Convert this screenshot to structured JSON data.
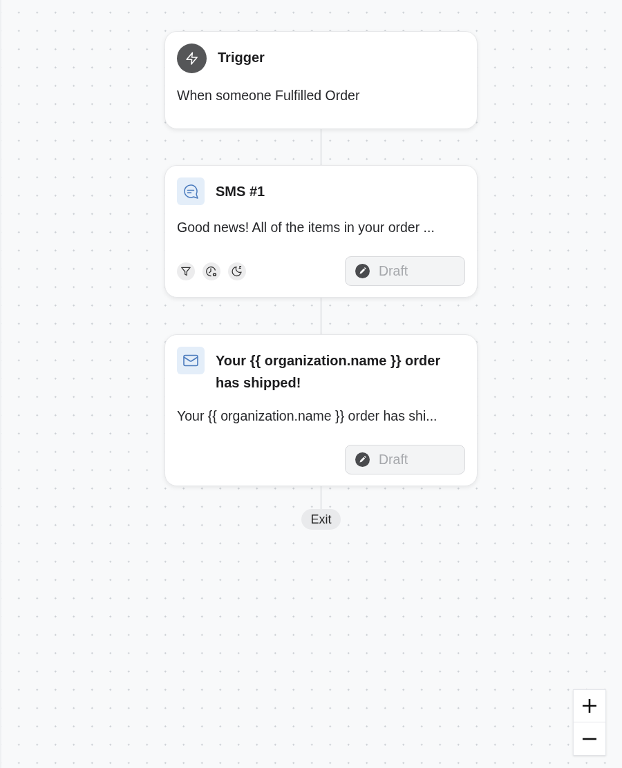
{
  "nodes": [
    {
      "kind": "trigger",
      "title": "Trigger",
      "description": "When someone Fulfilled Order"
    },
    {
      "kind": "sms",
      "title": "SMS #1",
      "description": "Good news! All of the items in your order ...",
      "indicators": [
        {
          "kind": "filter"
        },
        {
          "kind": "smart_sending"
        },
        {
          "kind": "quiet_hours"
        }
      ],
      "status": "Draft"
    },
    {
      "kind": "email",
      "title": "Your {{ organization.name }} order has shipped!",
      "description": "Your {{ organization.name }} order has shi...",
      "status": "Draft"
    }
  ],
  "exit": "Exit"
}
